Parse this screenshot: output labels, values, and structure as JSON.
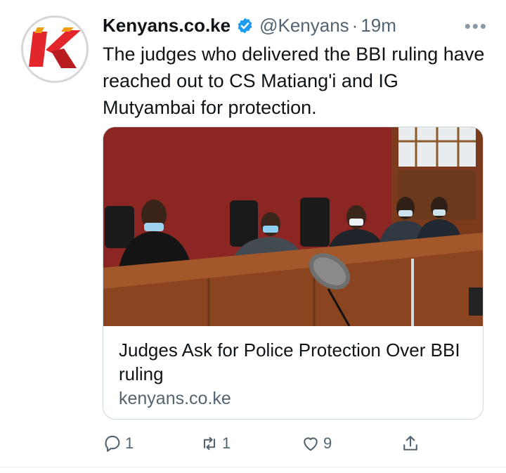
{
  "author": {
    "name": "Kenyans.co.ke",
    "handle": "@Kenyans",
    "separator": "·",
    "time": "19m",
    "verified": true,
    "avatar_icon": "kenyans-k-logo-icon"
  },
  "tweet": {
    "text": "The judges who delivered the BBI ruling have reached out to CS Matiang'i and IG Mutyambai for protection."
  },
  "card": {
    "image_icon": "courtroom-judges-photo",
    "title": "Judges Ask for Police Protection Over BBI ruling",
    "domain": "kenyans.co.ke"
  },
  "actions": {
    "reply_count": "1",
    "retweet_count": "1",
    "like_count": "9"
  },
  "colors": {
    "brand_red": "#e3262b",
    "verified_blue": "#1d9bf0",
    "secondary_text": "#536471"
  }
}
